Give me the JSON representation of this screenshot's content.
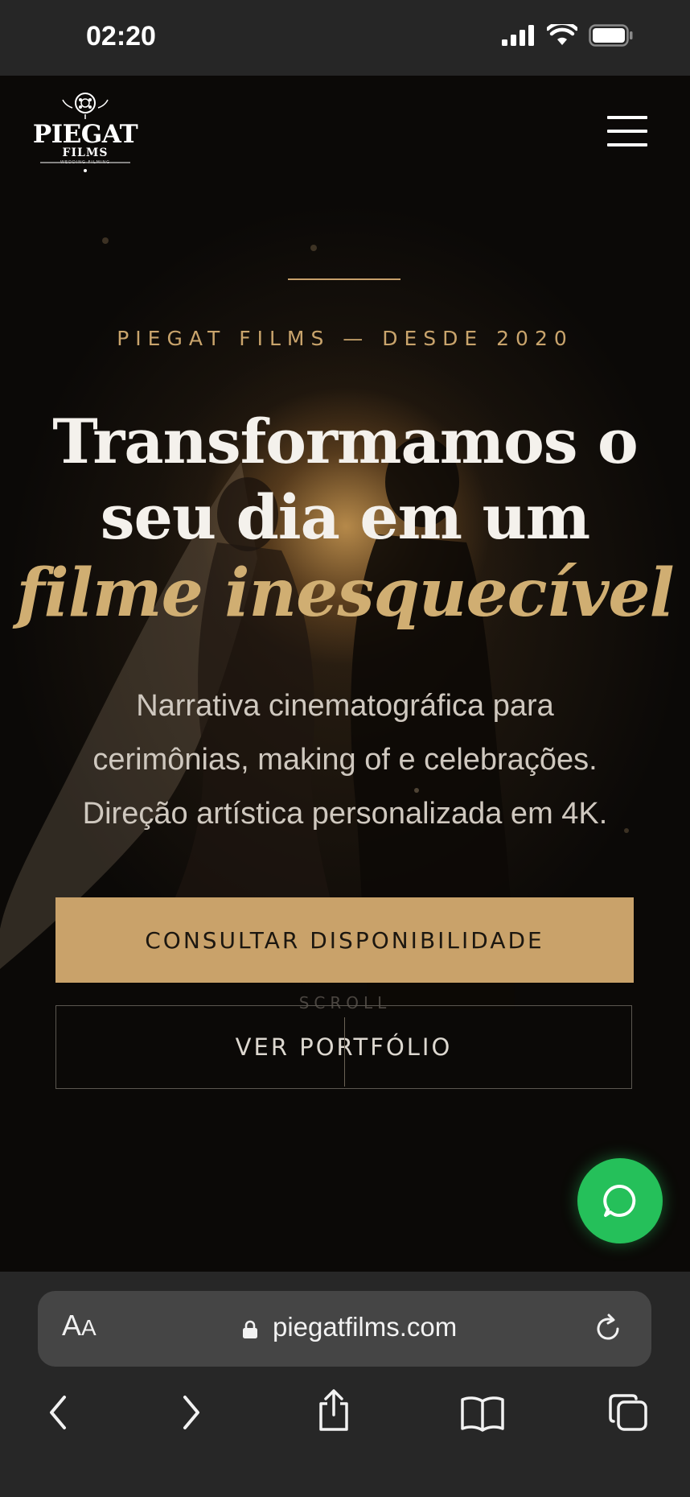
{
  "status_bar": {
    "time": "02:20"
  },
  "header": {
    "logo_text": "PIEGAT",
    "logo_sub": "FILMS",
    "logo_tagline": "WEDDING FILMING",
    "menu_icon": "hamburger-menu-icon"
  },
  "hero": {
    "eyebrow": "PIEGAT FILMS — DESDE 2020",
    "headline_line1": "Transformamos o",
    "headline_line2": "seu dia em um",
    "headline_accent": "filme inesquecível",
    "lead_line1": "Narrativa cinematográfica para",
    "lead_line2": "cerimônias, making of e celebrações.",
    "lead_line3": "Direção artística personalizada em 4K.",
    "primary_button": "CONSULTAR DISPONIBILIDADE",
    "scroll_label": "SCROLL",
    "secondary_button": "VER PORTFÓLIO"
  },
  "floating": {
    "whatsapp_icon": "whatsapp-chat-icon"
  },
  "browser": {
    "aa_big": "A",
    "aa_small": "A",
    "url": "piegatfilms.com",
    "icons": [
      "back-icon",
      "forward-icon",
      "share-icon",
      "bookmarks-icon",
      "tabs-icon"
    ]
  },
  "colors": {
    "accent_gold": "#c9a26a",
    "whatsapp_green": "#25c05a",
    "background": "#0b0907"
  }
}
